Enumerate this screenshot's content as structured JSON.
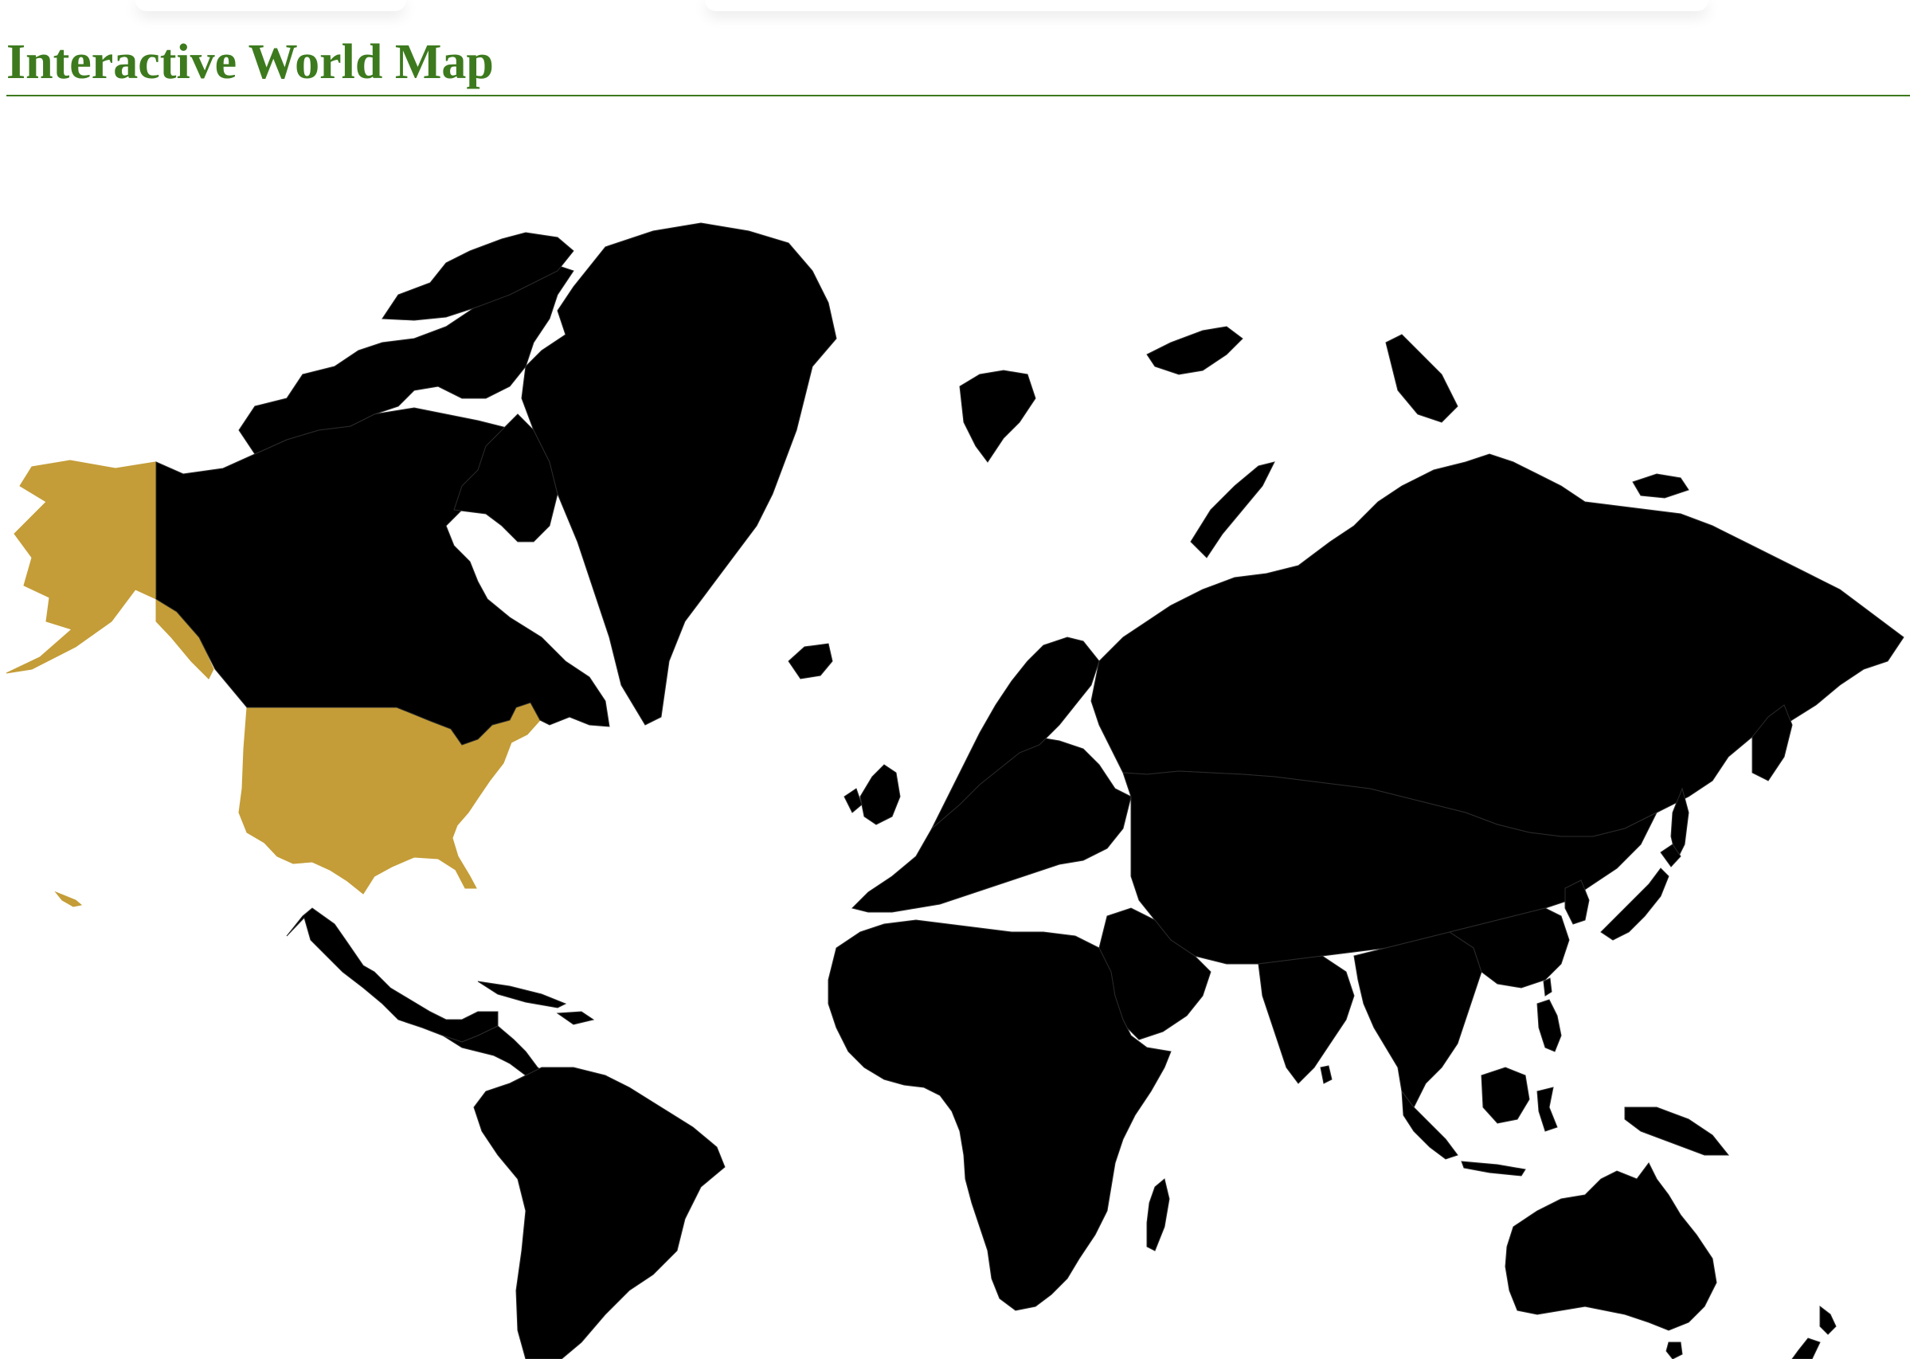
{
  "page": {
    "title": "Interactive World Map"
  },
  "colors": {
    "title": "#3d7a1e",
    "rule": "#3d7a1e",
    "land": "#000000",
    "highlight": "#c49d38",
    "background": "#ffffff"
  },
  "map": {
    "projection": "mercator",
    "highlighted_countries": [
      "United States"
    ]
  }
}
